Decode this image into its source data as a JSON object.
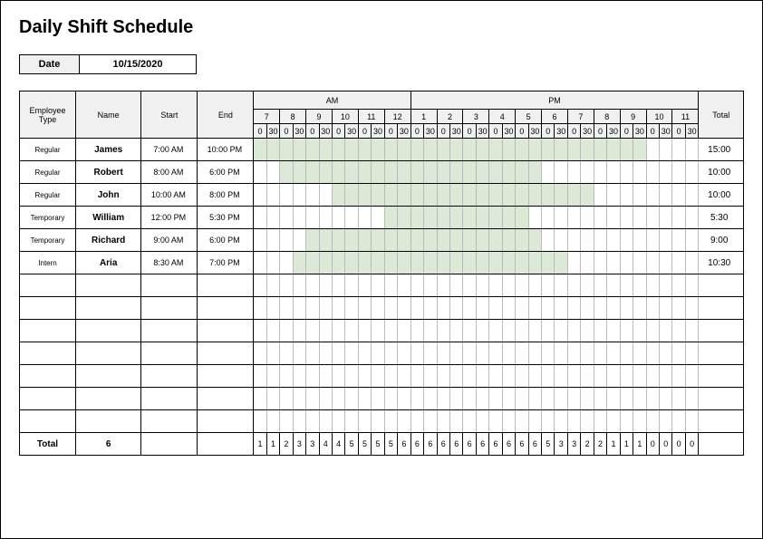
{
  "title": "Daily Shift Schedule",
  "date_label": "Date",
  "date_value": "10/15/2020",
  "header": {
    "employee_type": "Employee Type",
    "name": "Name",
    "start": "Start",
    "end": "End",
    "am": "AM",
    "pm": "PM",
    "total": "Total",
    "hours": [
      "7",
      "8",
      "9",
      "10",
      "11",
      "12",
      "1",
      "2",
      "3",
      "4",
      "5",
      "6",
      "7",
      "8",
      "9",
      "10",
      "11"
    ],
    "halves": [
      "0",
      "30"
    ]
  },
  "rows": [
    {
      "type": "Regular",
      "name": "James",
      "start": "7:00 AM",
      "end": "10:00 PM",
      "start_idx": 0,
      "end_idx": 30,
      "total": "15:00"
    },
    {
      "type": "Regular",
      "name": "Robert",
      "start": "8:00 AM",
      "end": "6:00 PM",
      "start_idx": 2,
      "end_idx": 22,
      "total": "10:00"
    },
    {
      "type": "Regular",
      "name": "John",
      "start": "10:00 AM",
      "end": "8:00 PM",
      "start_idx": 6,
      "end_idx": 26,
      "total": "10:00"
    },
    {
      "type": "Temporary",
      "name": "William",
      "start": "12:00 PM",
      "end": "5:30 PM",
      "start_idx": 10,
      "end_idx": 21,
      "total": "5:30"
    },
    {
      "type": "Temporary",
      "name": "Richard",
      "start": "9:00 AM",
      "end": "6:00 PM",
      "start_idx": 4,
      "end_idx": 22,
      "total": "9:00"
    },
    {
      "type": "Intern",
      "name": "Aria",
      "start": "8:30 AM",
      "end": "7:00 PM",
      "start_idx": 3,
      "end_idx": 24,
      "total": "10:30"
    }
  ],
  "empty_rows": 7,
  "footer": {
    "label": "Total",
    "count": "6",
    "slot_totals": [
      1,
      1,
      2,
      3,
      3,
      4,
      4,
      5,
      5,
      5,
      5,
      6,
      6,
      6,
      6,
      6,
      6,
      6,
      6,
      6,
      6,
      6,
      5,
      3,
      3,
      2,
      2,
      1,
      1,
      1,
      0,
      0,
      0,
      0
    ]
  },
  "slots": 34
}
